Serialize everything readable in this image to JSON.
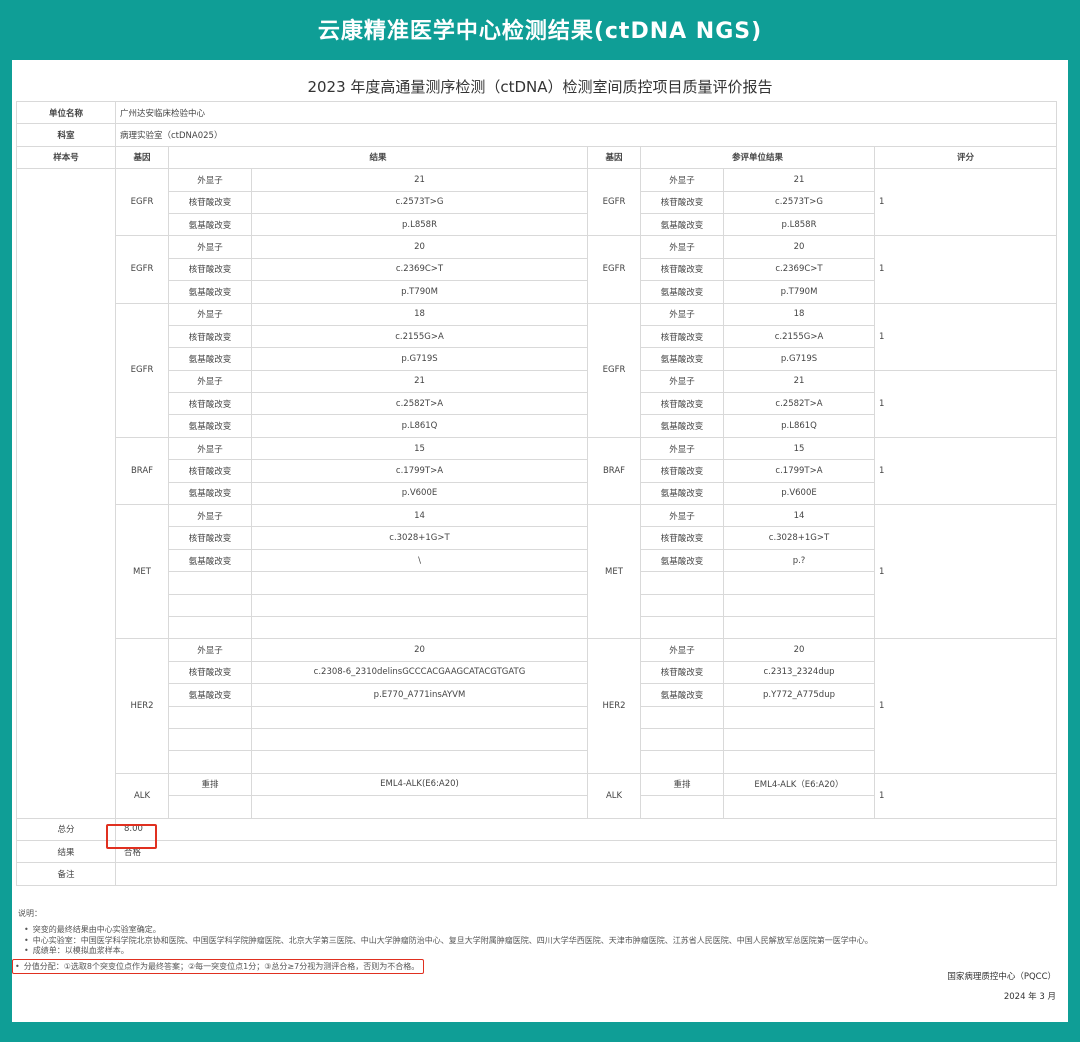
{
  "banner_title": "云康精准医学中心检测结果(ctDNA NGS)",
  "doc_title": "2023 年度高通量测序检测（ctDNA）检测室间质控项目质量评价报告",
  "unit_label": "单位名称",
  "unit_value": "广州达安临床检验中心",
  "dept_label": "科室",
  "dept_value": "病理实验室（ctDNA025）",
  "headers": {
    "sample": "样本号",
    "gene": "基因",
    "result": "结果",
    "gene2": "基因",
    "ref": "参评单位结果",
    "score": "评分"
  },
  "rows": [
    {
      "g": "EGFR",
      "k": "外显子",
      "r": "21",
      "g2": "EGFR",
      "k2": "外显子",
      "e": "21",
      "s": "1"
    },
    {
      "g": "",
      "k": "核苷酸改变",
      "r": "c.2573T>G",
      "g2": "",
      "k2": "核苷酸改变",
      "e": "c.2573T>G",
      "s": ""
    },
    {
      "g": "",
      "k": "氨基酸改变",
      "r": "p.L858R",
      "g2": "",
      "k2": "氨基酸改变",
      "e": "p.L858R",
      "s": ""
    },
    {
      "g": "EGFR",
      "k": "外显子",
      "r": "20",
      "g2": "EGFR",
      "k2": "外显子",
      "e": "20",
      "s": "1"
    },
    {
      "g": "",
      "k": "核苷酸改变",
      "r": "c.2369C>T",
      "g2": "",
      "k2": "核苷酸改变",
      "e": "c.2369C>T",
      "s": ""
    },
    {
      "g": "",
      "k": "氨基酸改变",
      "r": "p.T790M",
      "g2": "",
      "k2": "氨基酸改变",
      "e": "p.T790M",
      "s": ""
    },
    {
      "g": "EGFR",
      "k": "外显子",
      "r": "18",
      "g2": "EGFR",
      "k2": "外显子",
      "e": "18",
      "s": "1"
    },
    {
      "g": "",
      "k": "核苷酸改变",
      "r": "c.2155G>A",
      "g2": "",
      "k2": "核苷酸改变",
      "e": "c.2155G>A",
      "s": ""
    },
    {
      "g": "",
      "k": "氨基酸改变",
      "r": "p.G719S",
      "g2": "",
      "k2": "氨基酸改变",
      "e": "p.G719S",
      "s": ""
    },
    {
      "g": "EGFR",
      "k": "外显子",
      "r": "21",
      "g2": "EGFR",
      "k2": "外显子",
      "e": "21",
      "s": "1"
    },
    {
      "g": "",
      "k": "核苷酸改变",
      "r": "c.2582T>A",
      "g2": "",
      "k2": "核苷酸改变",
      "e": "c.2582T>A",
      "s": ""
    },
    {
      "g": "",
      "k": "氨基酸改变",
      "r": "p.L861Q",
      "g2": "",
      "k2": "氨基酸改变",
      "e": "p.L861Q",
      "s": ""
    },
    {
      "g": "BRAF",
      "k": "外显子",
      "r": "15",
      "g2": "BRAF",
      "k2": "外显子",
      "e": "15",
      "s": "1"
    },
    {
      "g": "",
      "k": "核苷酸改变",
      "r": "c.1799T>A",
      "g2": "",
      "k2": "核苷酸改变",
      "e": "c.1799T>A",
      "s": ""
    },
    {
      "g": "",
      "k": "氨基酸改变",
      "r": "p.V600E",
      "g2": "",
      "k2": "氨基酸改变",
      "e": "p.V600E",
      "s": ""
    },
    {
      "g": "MET",
      "k": "外显子",
      "r": "14",
      "g2": "MET",
      "k2": "外显子",
      "e": "14",
      "s": "1"
    },
    {
      "g": "",
      "k": "核苷酸改变",
      "r": "c.3028+1G>T",
      "g2": "",
      "k2": "核苷酸改变",
      "e": "c.3028+1G>T",
      "s": ""
    },
    {
      "g": "",
      "k": "氨基酸改变",
      "r": "\\",
      "g2": "",
      "k2": "氨基酸改变",
      "e": "p.?",
      "s": ""
    },
    {
      "g": "",
      "k": "",
      "r": "",
      "g2": "",
      "k2": "",
      "e": "",
      "s": ""
    },
    {
      "g": "",
      "k": "",
      "r": "",
      "g2": "",
      "k2": "",
      "e": "",
      "s": ""
    },
    {
      "g": "",
      "k": "",
      "r": "",
      "g2": "",
      "k2": "",
      "e": "",
      "s": ""
    },
    {
      "g": "HER2",
      "k": "外显子",
      "r": "20",
      "g2": "HER2",
      "k2": "外显子",
      "e": "20",
      "s": "1"
    },
    {
      "g": "",
      "k": "核苷酸改变",
      "r": "c.2308-6_2310delinsGCCCACGAAGCATACGTGATG",
      "g2": "",
      "k2": "核苷酸改变",
      "e": "c.2313_2324dup",
      "s": ""
    },
    {
      "g": "",
      "k": "氨基酸改变",
      "r": "p.E770_A771insAYVM",
      "g2": "",
      "k2": "氨基酸改变",
      "e": "p.Y772_A775dup",
      "s": ""
    },
    {
      "g": "",
      "k": "",
      "r": "",
      "g2": "",
      "k2": "",
      "e": "",
      "s": ""
    },
    {
      "g": "",
      "k": "",
      "r": "",
      "g2": "",
      "k2": "",
      "e": "",
      "s": ""
    },
    {
      "g": "",
      "k": "",
      "r": "",
      "g2": "",
      "k2": "",
      "e": "",
      "s": ""
    },
    {
      "g": "ALK",
      "k": "重排",
      "r": "EML4-ALK(E6:A20)",
      "g2": "ALK",
      "k2": "重排",
      "e": "EML4-ALK（E6:A20）",
      "s": "1"
    },
    {
      "g": "",
      "k": "",
      "r": "",
      "g2": "",
      "k2": "",
      "e": "",
      "s": ""
    }
  ],
  "total_label": "总分",
  "total_value": "8.00",
  "result_label": "结果",
  "result_value": "合格",
  "remark_label": "备注",
  "remark_value": "",
  "notes_title": "说明：",
  "notes": [
    "突变的最终结果由中心实验室确定。",
    "中心实验室：中国医学科学院北京协和医院、中国医学科学院肿瘤医院、北京大学第三医院、中山大学肿瘤防治中心、复旦大学附属肿瘤医院、四川大学华西医院、天津市肿瘤医院、江苏省人民医院、中国人民解放军总医院第一医学中心。",
    "成绩单：以模拟血浆样本。"
  ],
  "scoring_note": "分值分配：①选取8个突变位点作为最终答案；②每一突变位点1分；③总分≥7分视为测评合格，否则为不合格。",
  "footer_org": "国家病理质控中心（PQCC）",
  "footer_date": "2024 年 3 月",
  "colors": {
    "teal": "#0f9e96",
    "highlight_red": "#e03020"
  }
}
